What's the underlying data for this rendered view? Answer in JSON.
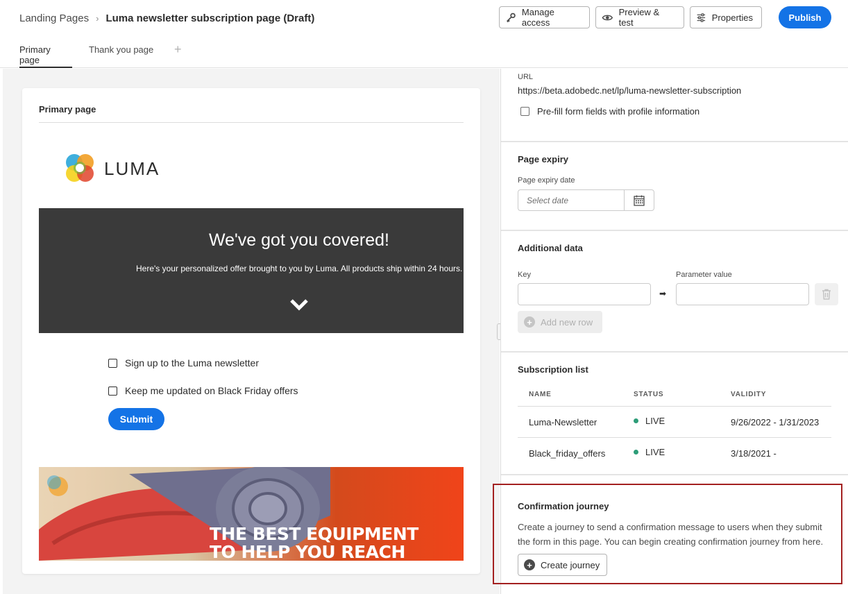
{
  "header": {
    "breadcrumb_root": "Landing Pages",
    "breadcrumb_current": "Luma newsletter subscription page (Draft)",
    "manage_access": "Manage access",
    "preview_test": "Preview & test",
    "properties": "Properties",
    "publish": "Publish"
  },
  "tabs": {
    "primary": "Primary page",
    "thank_you": "Thank you page",
    "add": "+"
  },
  "canvas": {
    "card_title": "Primary page",
    "logo_text": "LUMA",
    "hero_title": "We've got you covered!",
    "hero_subtitle": "Here's your personalized offer brought to you by Luma. All products ship within 24 hours.",
    "checkbox_newsletter": "Sign up to the Luma newsletter",
    "checkbox_black_friday": "Keep me updated on Black Friday offers",
    "submit": "Submit",
    "banner_text_1": "THE BEST EQUIPMENT",
    "banner_text_2": "TO HELP YOU REACH"
  },
  "panel": {
    "url_label": "URL",
    "url_value": "https://beta.adobedc.net/lp/luma-newsletter-subscription",
    "prefill_label": "Pre-fill form fields with profile information",
    "expiry_title": "Page expiry",
    "expiry_label": "Page expiry date",
    "expiry_placeholder": "Select date",
    "additional_title": "Additional data",
    "key_label": "Key",
    "param_label": "Parameter value",
    "add_row": "Add new row",
    "subscription_title": "Subscription list",
    "columns": {
      "name": "NAME",
      "status": "STATUS",
      "validity": "VALIDITY"
    },
    "rows": [
      {
        "name": "Luma-Newsletter",
        "status": "LIVE",
        "validity": "9/26/2022 - 1/31/2023"
      },
      {
        "name": "Black_friday_offers",
        "status": "LIVE",
        "validity": "3/18/2021 -"
      }
    ],
    "journey_title": "Confirmation journey",
    "journey_desc": "Create a journey to send a confirmation message to users when they submit the form in this page. You can begin creating confirmation journey from here.",
    "create_journey": "Create journey"
  },
  "colors": {
    "accent": "#1473e6",
    "live": "#2d9d78",
    "highlight_border": "#a32020"
  }
}
